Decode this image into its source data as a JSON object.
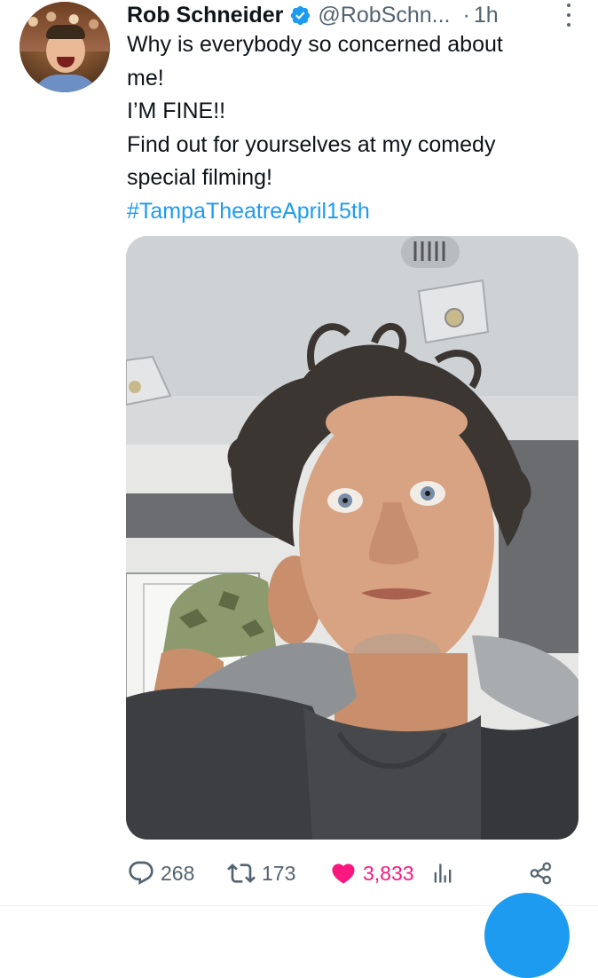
{
  "author": {
    "name": "Rob Schneider",
    "handle": "@RobSchn...",
    "separator": "·",
    "time": "1h",
    "verified": true,
    "avatar_icon": "profile-photo"
  },
  "tweet": {
    "lines": [
      "Why is everybody so concerned about",
      "me!",
      "I’M FINE!!",
      "Find out for yourselves at my comedy",
      "special filming!"
    ],
    "hashtag": "#TampaTheatreApril15th"
  },
  "media": {
    "type": "photo",
    "icon": "photo"
  },
  "actions": {
    "replies": "268",
    "retweets": "173",
    "likes": "3,833",
    "liked": true
  },
  "colors": {
    "accent": "#1d9bf0",
    "like": "#f91880",
    "secondary_text": "#536471"
  }
}
